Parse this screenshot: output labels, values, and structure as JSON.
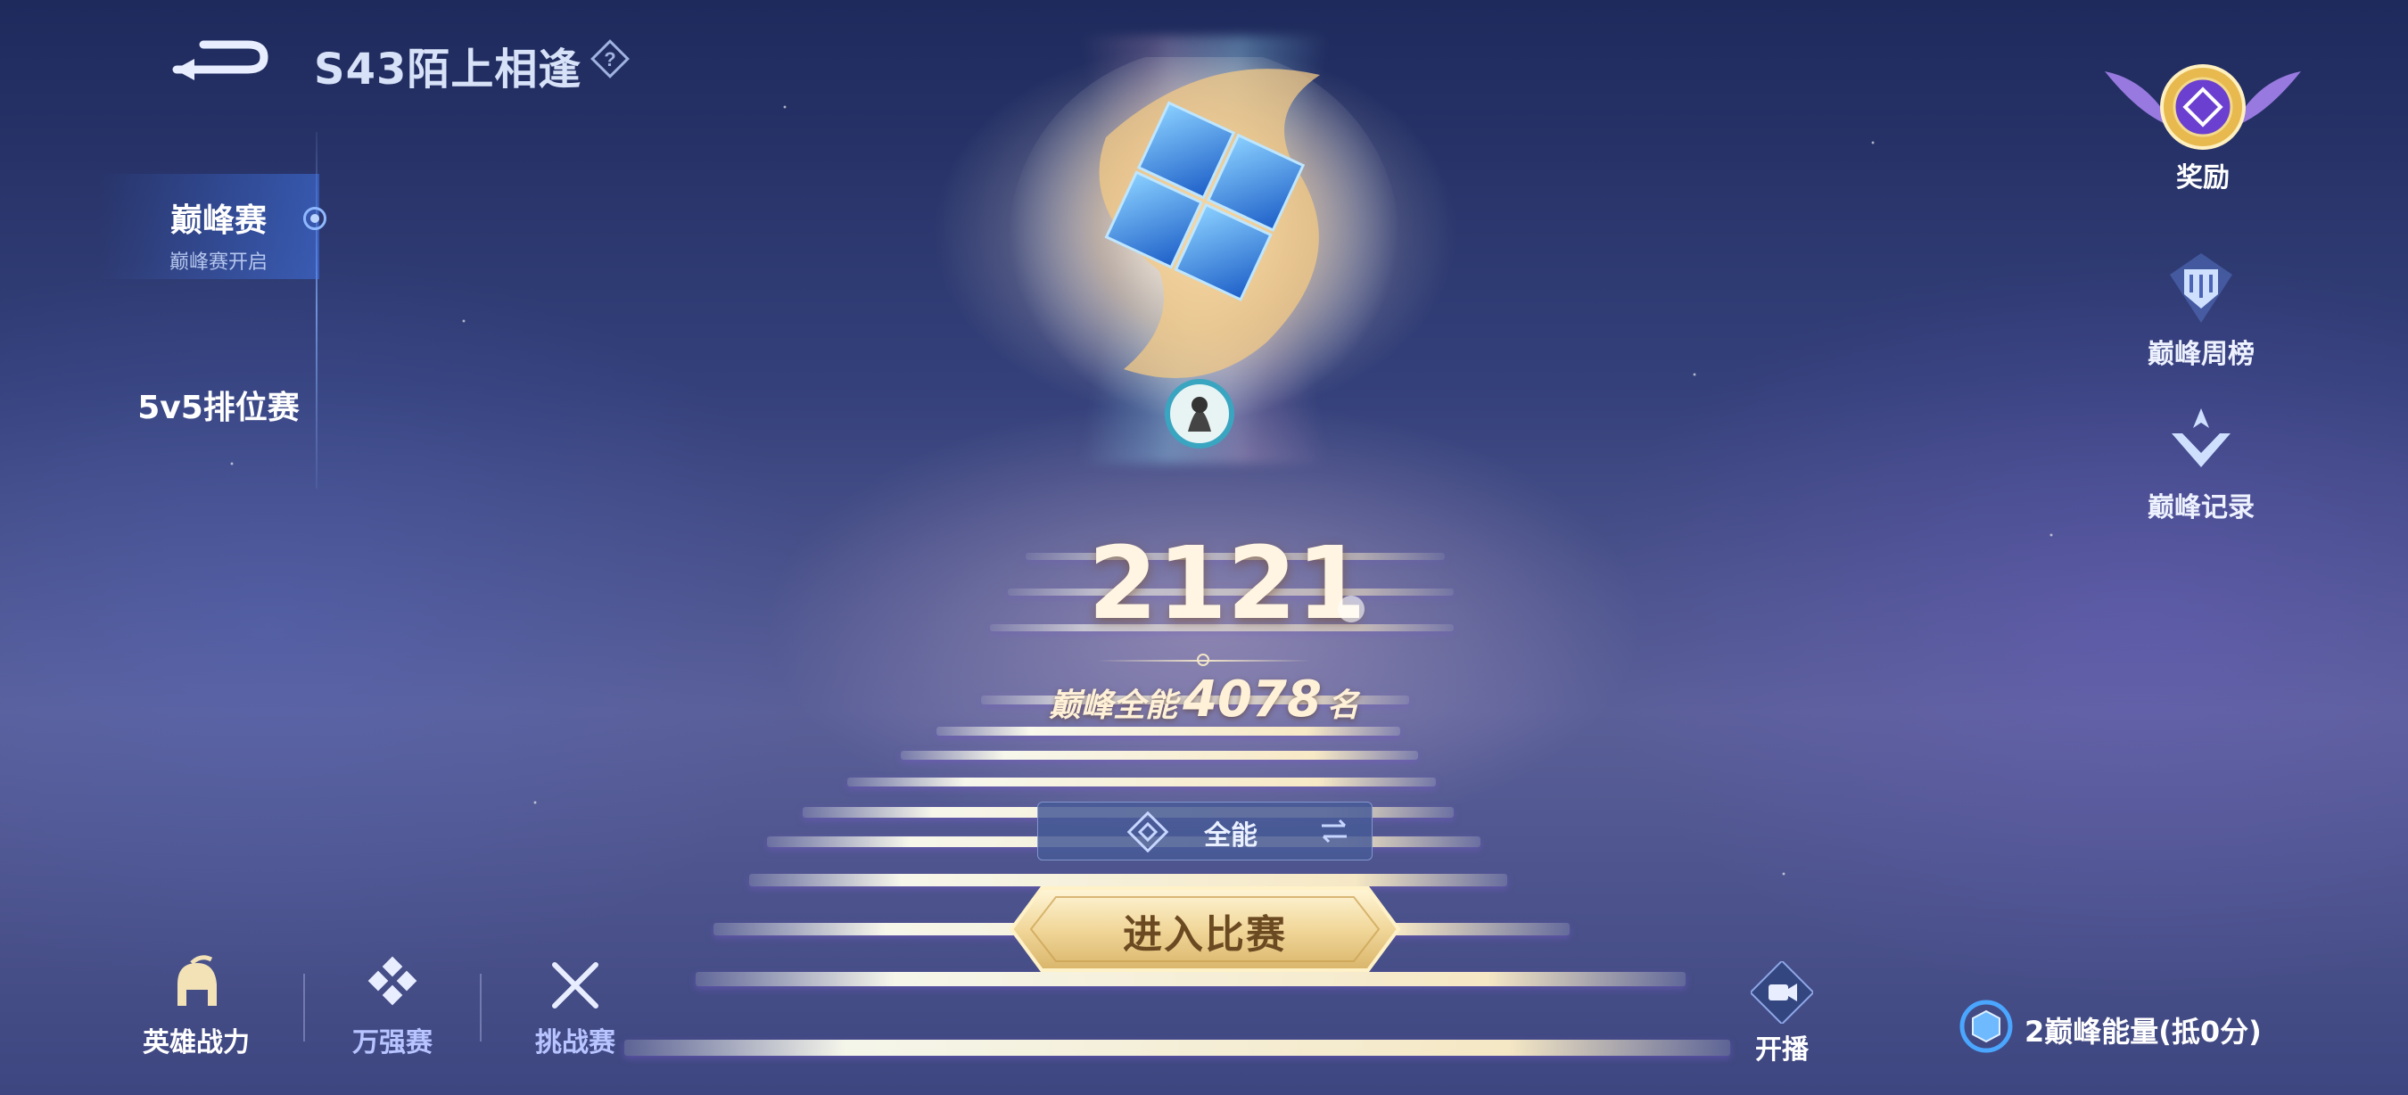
{
  "header": {
    "season_title": "S43陌上相逢"
  },
  "sidebar": {
    "items": [
      {
        "label": "巅峰赛",
        "sublabel": "巅峰赛开启",
        "active": true
      },
      {
        "label": "5v5排位赛",
        "active": false
      }
    ]
  },
  "center": {
    "score": "2121",
    "rank_prefix": "巅峰全能",
    "rank_number": "4078",
    "rank_suffix": "名",
    "mode_label": "全能",
    "enter_button": "进入比赛"
  },
  "right_panel": {
    "reward_label": "奖励",
    "items": [
      {
        "label": "巅峰周榜",
        "icon": "trophy-tower-icon"
      },
      {
        "label": "巅峰记录",
        "icon": "chevron-record-icon"
      }
    ]
  },
  "bottom_bar": {
    "items": [
      {
        "label": "英雄战力",
        "icon": "helmet-icon",
        "color": "#ffffff"
      },
      {
        "label": "万强赛",
        "icon": "diamond-grid-icon",
        "color": "#b7c4ff"
      },
      {
        "label": "挑战赛",
        "icon": "crossed-swords-icon",
        "color": "#b7c4ff"
      }
    ],
    "live_label": "开播",
    "energy_label": "2巅峰能量(抵0分)"
  },
  "colors": {
    "accent_gold": "#e9c879",
    "active_nav": "#5a8dff",
    "panel_blue": "#46598f"
  }
}
